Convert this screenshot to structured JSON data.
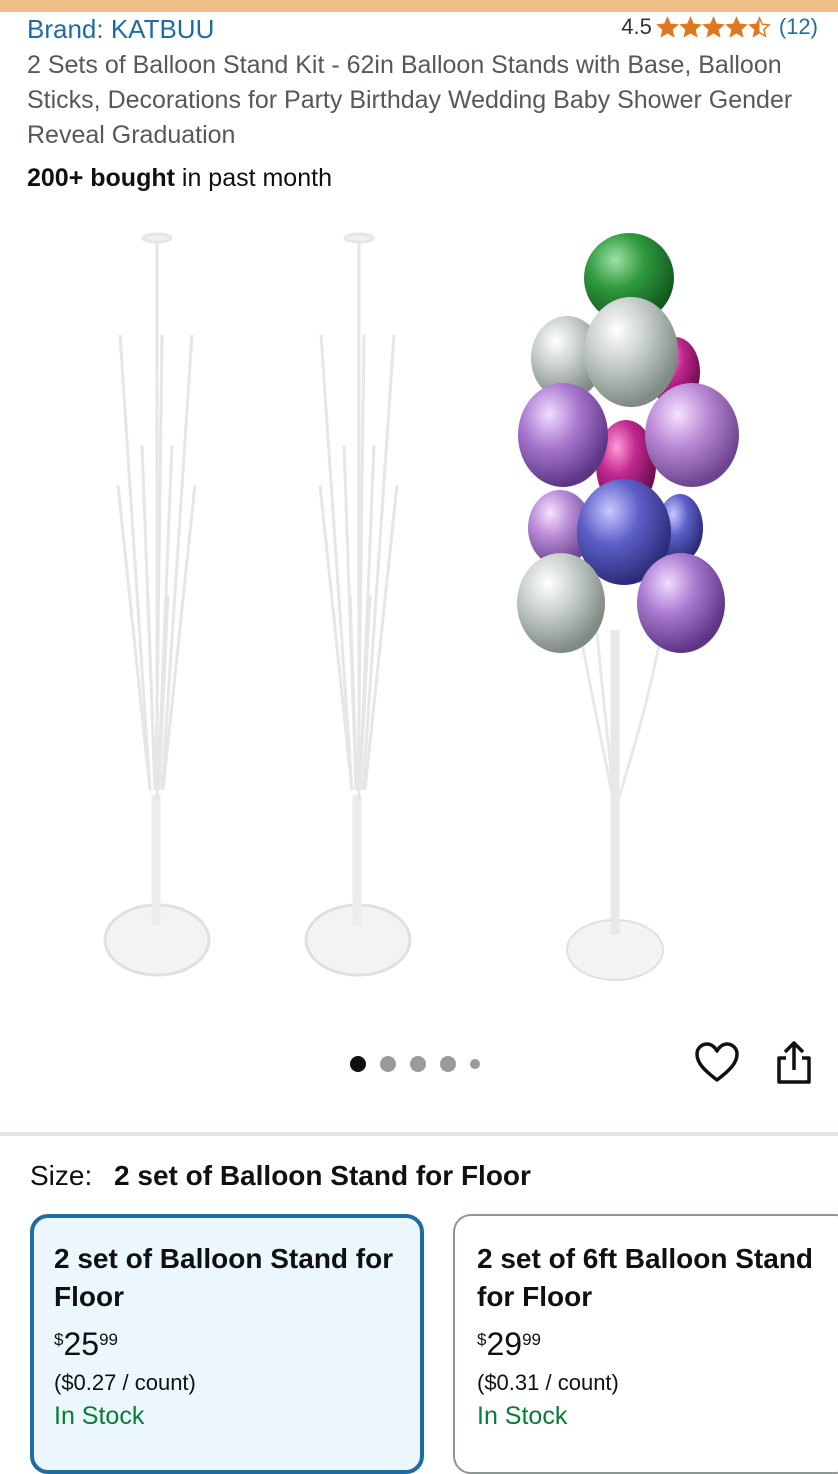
{
  "header": {
    "brand": "Brand: KATBUU",
    "rating_value": "4.5",
    "rating_fraction": 0.9,
    "rating_count": "(12)",
    "title": "2 Sets of Balloon Stand Kit - 62in Balloon Stands with Base, Balloon Sticks, Decorations for Party Birthday Wedding Baby Shower Gender Reveal Graduation",
    "bought_bold": "200+ bought",
    "bought_rest": " in past month"
  },
  "gallery": {
    "dots_total": 5,
    "active_dot": 1,
    "icons": [
      "heart-icon",
      "share-icon"
    ]
  },
  "size": {
    "label": "Size:",
    "selected": "2 set of Balloon Stand for Floor",
    "options": [
      {
        "name": "2 set of Balloon Stand for Floor",
        "currency": "$",
        "price_whole": "25",
        "price_fraction": "99",
        "unit_price": "($0.27 / count)",
        "stock": "In Stock"
      },
      {
        "name": "2 set of 6ft Balloon Stand for Floor",
        "currency": "$",
        "price_whole": "29",
        "price_fraction": "99",
        "unit_price": "($0.31 / count)",
        "stock": "In Stock"
      }
    ]
  },
  "colors": {
    "link": "#1f6ca3",
    "star": "#de7921",
    "in_stock": "#067d35",
    "selected_border": "#1f6ca3",
    "top_bar": "#f0be86"
  }
}
